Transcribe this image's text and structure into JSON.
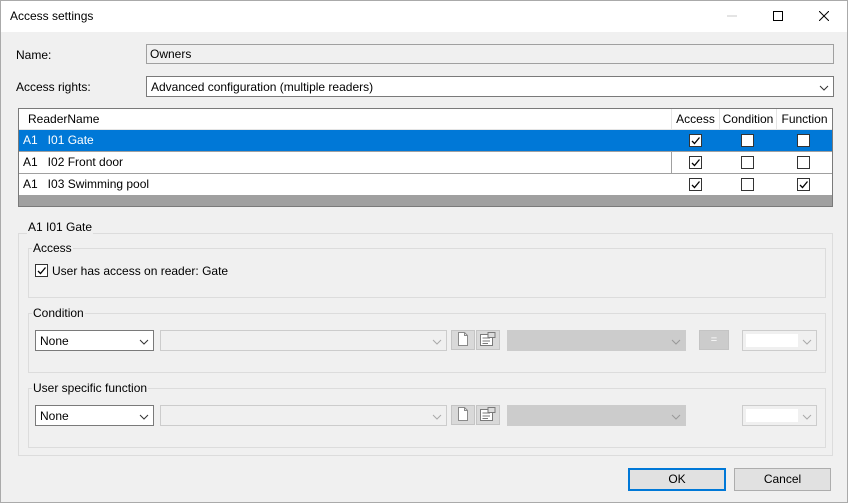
{
  "window": {
    "title": "Access settings"
  },
  "form": {
    "name_label": "Name:",
    "name_value": "Owners",
    "access_rights_label": "Access rights:",
    "access_rights_value": "Advanced configuration (multiple readers)"
  },
  "grid": {
    "columns": [
      "ReaderName",
      "Access",
      "Condition",
      "Function"
    ],
    "rows": [
      {
        "name": "A1   I01 Gate",
        "access": true,
        "condition": false,
        "function": false,
        "selected": true
      },
      {
        "name": "A1   I02 Front door",
        "access": true,
        "condition": false,
        "function": false,
        "selected": false
      },
      {
        "name": "A1   I03 Swimming pool",
        "access": true,
        "condition": false,
        "function": true,
        "selected": false
      }
    ]
  },
  "detail": {
    "title": "A1   I01 Gate",
    "access_group": "Access",
    "access_checkbox_label": "User has access on reader: Gate",
    "access_checked": true,
    "condition_group": "Condition",
    "condition_value": "None",
    "condition_eq_label": "=",
    "function_group": "User specific function",
    "function_value": "None"
  },
  "buttons": {
    "ok": "OK",
    "cancel": "Cancel"
  },
  "colors": {
    "selection": "#0078d7",
    "default_button_border": "#0078d7"
  }
}
